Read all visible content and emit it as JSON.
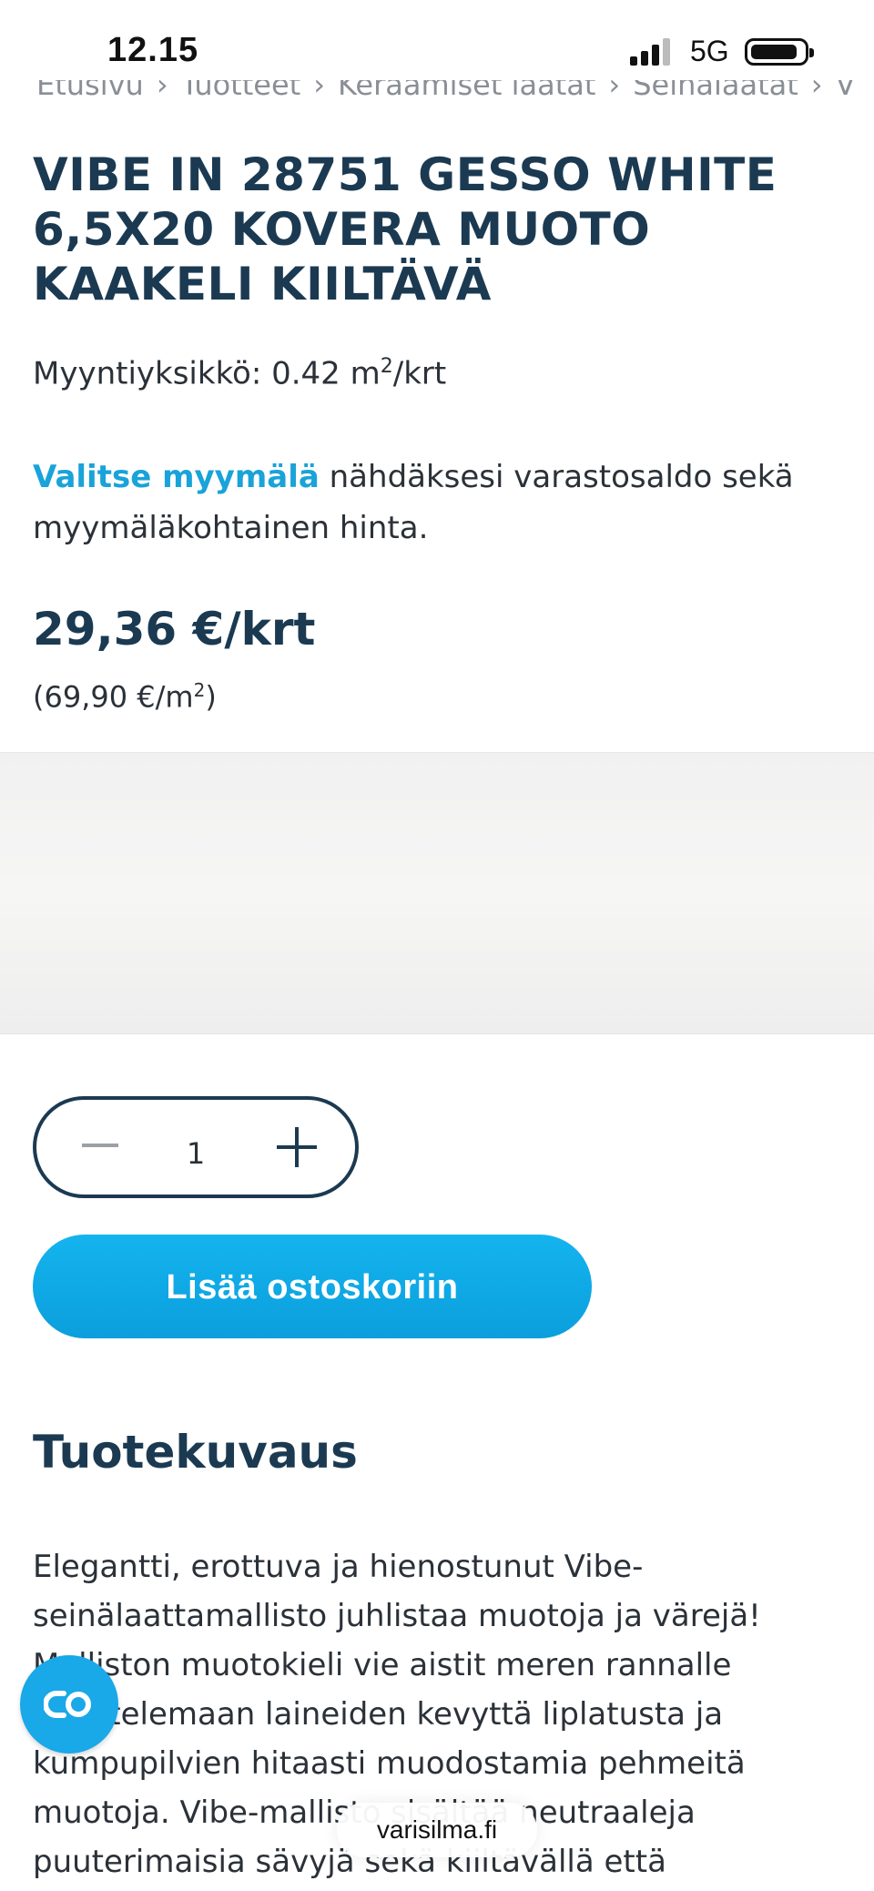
{
  "status_bar": {
    "time": "12.15",
    "network": "5G"
  },
  "breadcrumb": {
    "items": [
      "Etusivu",
      "Tuotteet",
      "Keraamiset laatat",
      "Seinälaatat",
      "Vibe"
    ]
  },
  "product": {
    "title": "VIBE IN 28751 GESSO WHITE 6,5X20 KOVERA MUOTO KAAKELI KIILTÄVÄ",
    "sales_unit_prefix": "Myyntiyksikkö: 0.42 m",
    "sales_unit_sup": "2",
    "sales_unit_suffix": "/krt",
    "store_link": "Valitse myymälä",
    "store_text": " nähdäksesi varastosaldo sekä myymäläkohtainen hinta.",
    "price": "29,36 €/krt",
    "unit_price_prefix": "(69,90 €/m",
    "unit_price_sup": "2",
    "unit_price_suffix": ")"
  },
  "quantity": {
    "value": "1"
  },
  "add_to_cart": "Lisää ostoskoriin",
  "description": {
    "heading": "Tuotekuvaus",
    "text": "Elegantti, erottuva ja hienostunut Vibe-seinälaattamallisto juhlistaa muotoja ja värejä! Malliston muotokieli vie aistit meren rannalle kuuntelemaan laineiden kevyttä liplatusta ja kumpupilvien hitaasti muodostamia pehmeitä muotoja. Vibe-mallisto sisältää neutraaleja puuterimaisia sävyjä sekä kiiltävällä että"
  },
  "url_bar": "varisilma.fi",
  "colors": {
    "brand_dark": "#1b3a52",
    "accent": "#19a3d9",
    "button": "#0aa6e6"
  }
}
